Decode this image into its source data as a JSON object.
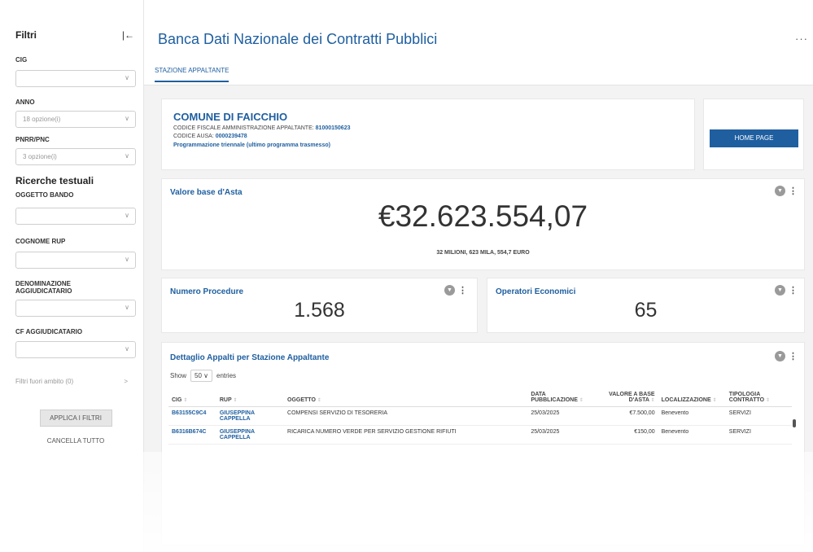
{
  "sidebar": {
    "title": "Filtri",
    "collapse_icon": "collapse-left-icon",
    "cig": {
      "label": "CIG",
      "value": ""
    },
    "anno": {
      "label": "ANNO",
      "placeholder": "18 opzione(i)"
    },
    "pnrr": {
      "label": "PNRR/PNC",
      "placeholder": "3 opzione(i)"
    },
    "text_search_title": "Ricerche testuali",
    "oggetto": {
      "label": "OGGETTO BANDO",
      "value": ""
    },
    "rup": {
      "label": "COGNOME RUP",
      "value": ""
    },
    "denominazione": {
      "label": "DENOMINAZIONE AGGIUDICATARIO",
      "value": ""
    },
    "cf": {
      "label": "CF AGGIUDICATARIO",
      "value": ""
    },
    "outside_filters": "Filtri fuori ambito (0)",
    "apply_label": "APPLICA I FILTRI",
    "clear_label": "CANCELLA TUTTO"
  },
  "header": {
    "title": "Banca Dati Nazionale dei Contratti Pubblici",
    "more": "···"
  },
  "tabs": [
    {
      "label": "STAZIONE APPALTANTE"
    }
  ],
  "ente": {
    "name": "COMUNE DI FAICCHIO",
    "cf_label": "CODICE FISCALE AMMINISTRAZIONE APPALTANTE:",
    "cf_value": "81000150623",
    "ausa_label": "CODICE AUSA:",
    "ausa_value": "0000239478",
    "link": "Programmazione triennale (ultimo programma trasmesso)"
  },
  "home_button": "HOME PAGE",
  "valore": {
    "title": "Valore base d'Asta",
    "value": "€32.623.554,07",
    "sub": "32 MILIONI, 623 MILA, 554,7 EURO"
  },
  "procedure": {
    "title": "Numero Procedure",
    "value": "1.568"
  },
  "operatori": {
    "title": "Operatori Economici",
    "value": "65"
  },
  "dettaglio": {
    "title": "Dettaglio Appalti per Stazione Appaltante",
    "show_label": "Show",
    "entries_value": "50",
    "entries_label": "entries",
    "columns": [
      "CIG",
      "RUP",
      "OGGETTO",
      "DATA PUBBLICAZIONE",
      "VALORE A BASE D'ASTA",
      "LOCALIZZAZIONE",
      "TIPOLOGIA CONTRATTO"
    ],
    "rows": [
      [
        "B63155C9C4",
        "GIUSEPPINA CAPPELLA",
        "COMPENSI SERVIZIO DI TESORERIA",
        "25/03/2025",
        "€7.500,00",
        "Benevento",
        "SERVIZI"
      ],
      [
        "B6316B674C",
        "GIUSEPPINA CAPPELLA",
        "RICARICA NUMERO VERDE PER SERVIZIO GESTIONE RIFIUTI",
        "25/03/2025",
        "€150,00",
        "Benevento",
        "SERVIZI"
      ]
    ]
  }
}
